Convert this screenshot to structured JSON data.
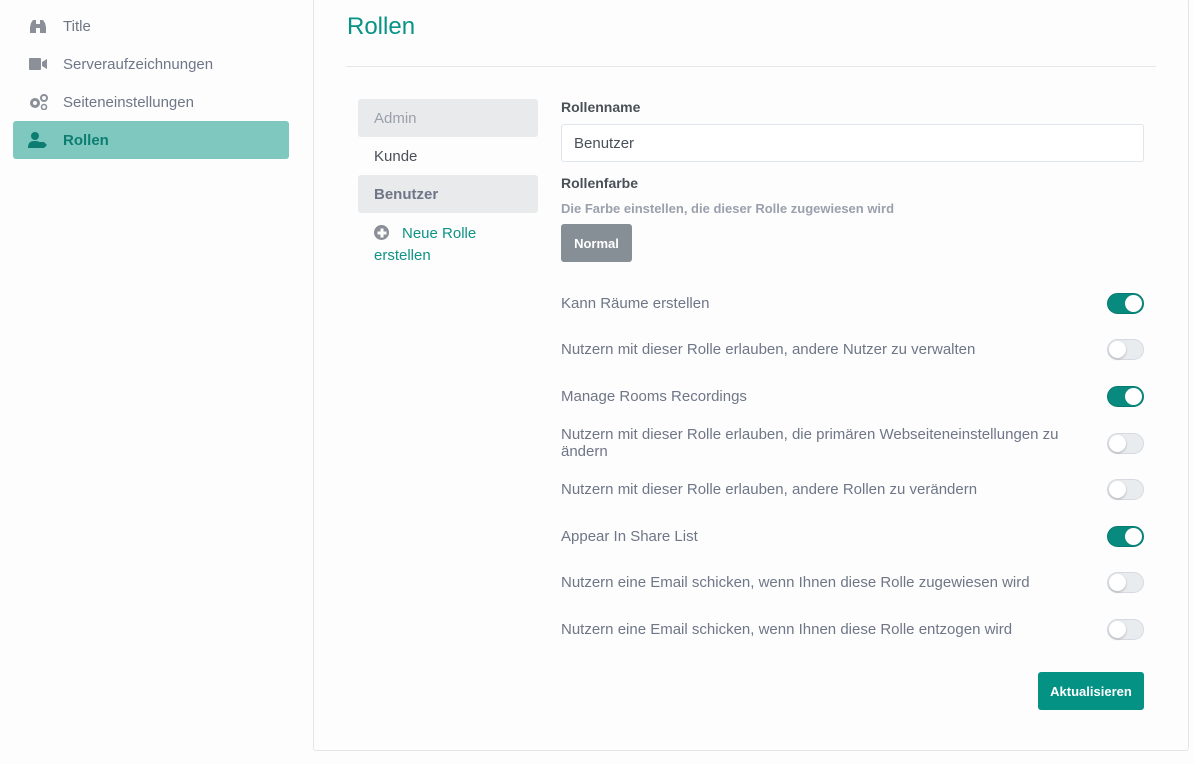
{
  "sidebar": {
    "items": [
      {
        "label": "Title",
        "icon": "binoculars-icon",
        "active": false
      },
      {
        "label": "Serveraufzeichnungen",
        "icon": "video-camera-icon",
        "active": false
      },
      {
        "label": "Seiteneinstellungen",
        "icon": "cogs-icon",
        "active": false
      },
      {
        "label": "Rollen",
        "icon": "user-tag-icon",
        "active": true
      }
    ]
  },
  "page": {
    "title": "Rollen"
  },
  "roles": {
    "items": [
      {
        "label": "Admin",
        "state": "disabled"
      },
      {
        "label": "Kunde",
        "state": "normal"
      },
      {
        "label": "Benutzer",
        "state": "selected"
      }
    ],
    "new_role_label": "Neue Rolle erstellen"
  },
  "form": {
    "role_name_label": "Rollenname",
    "role_name_value": "Benutzer",
    "role_color_label": "Rollenfarbe",
    "role_color_hint": "Die Farbe einstellen, die dieser Rolle zugewiesen wird",
    "role_color_button": "Normal",
    "permissions": [
      {
        "label": "Kann Räume erstellen",
        "enabled": true
      },
      {
        "label": "Nutzern mit dieser Rolle erlauben, andere Nutzer zu verwalten",
        "enabled": false
      },
      {
        "label": "Manage Rooms Recordings",
        "enabled": true
      },
      {
        "label": "Nutzern mit dieser Rolle erlauben, die primären Webseiteneinstellungen zu ändern",
        "enabled": false
      },
      {
        "label": "Nutzern mit dieser Rolle erlauben, andere Rollen zu verändern",
        "enabled": false
      },
      {
        "label": "Appear In Share List",
        "enabled": true
      },
      {
        "label": "Nutzern eine Email schicken, wenn Ihnen diese Rolle zugewiesen wird",
        "enabled": false
      },
      {
        "label": "Nutzern eine Email schicken, wenn Ihnen diese Rolle entzogen wird",
        "enabled": false
      }
    ],
    "submit_label": "Aktualisieren"
  },
  "colors": {
    "accent": "#079386",
    "sidebar_active_bg": "#7fc8c0",
    "toggle_on": "#088b7e",
    "color_button": "#868e96"
  }
}
